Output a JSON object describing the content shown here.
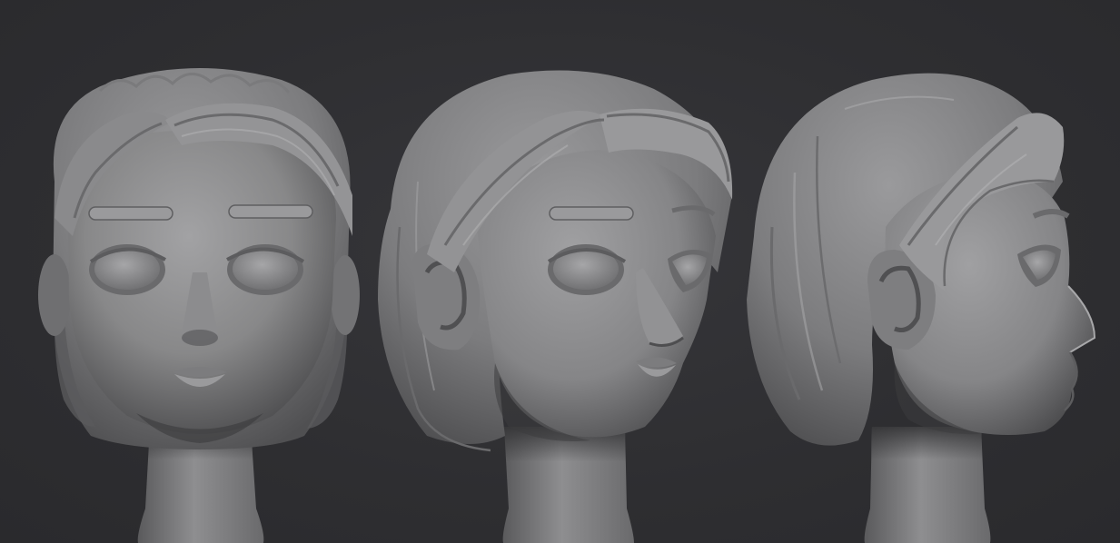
{
  "scene": {
    "background_color": "#303033",
    "material_color": "#8c8c8e",
    "views": [
      {
        "id": "front",
        "label": ""
      },
      {
        "id": "three-quarter",
        "label": ""
      },
      {
        "id": "profile",
        "label": ""
      }
    ]
  }
}
